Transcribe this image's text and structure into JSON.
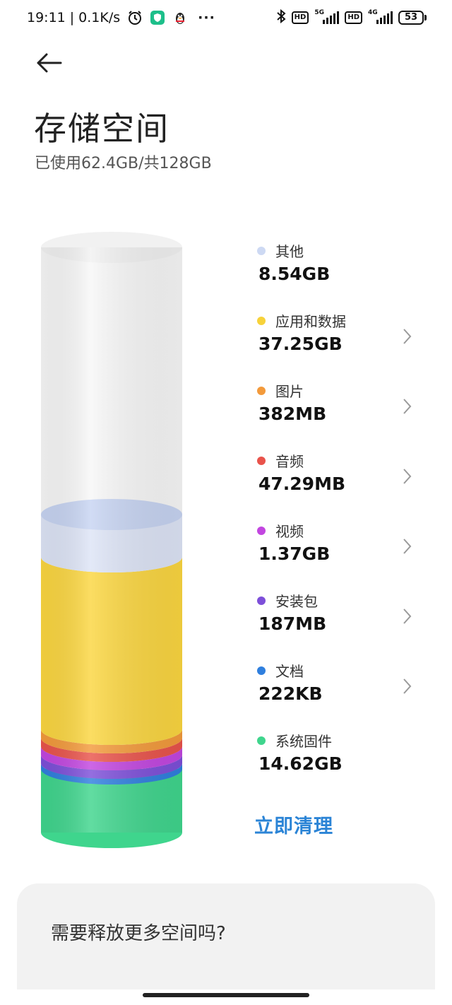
{
  "status": {
    "time": "19:11",
    "net_speed": "0.1K/s",
    "sim1_gen": "5G",
    "sim2_gen": "4G",
    "hd1": "HD",
    "hd2": "HD",
    "battery": "53",
    "more": "···"
  },
  "header": {
    "title": "存储空间",
    "subtitle": "已使用62.4GB/共128GB"
  },
  "storage": {
    "items": [
      {
        "label": "其他",
        "value": "8.54GB",
        "color": "#cdd9f3",
        "chevron": false
      },
      {
        "label": "应用和数据",
        "value": "37.25GB",
        "color": "#f7d23a",
        "chevron": true
      },
      {
        "label": "图片",
        "value": "382MB",
        "color": "#f39a3b",
        "chevron": true
      },
      {
        "label": "音频",
        "value": "47.29MB",
        "color": "#e9534b",
        "chevron": true
      },
      {
        "label": "视频",
        "value": "1.37GB",
        "color": "#c246e0",
        "chevron": true
      },
      {
        "label": "安装包",
        "value": "187MB",
        "color": "#7d4fd9",
        "chevron": true
      },
      {
        "label": "文档",
        "value": "222KB",
        "color": "#2f7fde",
        "chevron": true
      },
      {
        "label": "系统固件",
        "value": "14.62GB",
        "color": "#3fd58d",
        "chevron": false
      }
    ],
    "clean_label": "立即清理"
  },
  "bottom_card": {
    "title": "需要释放更多空间吗?"
  }
}
